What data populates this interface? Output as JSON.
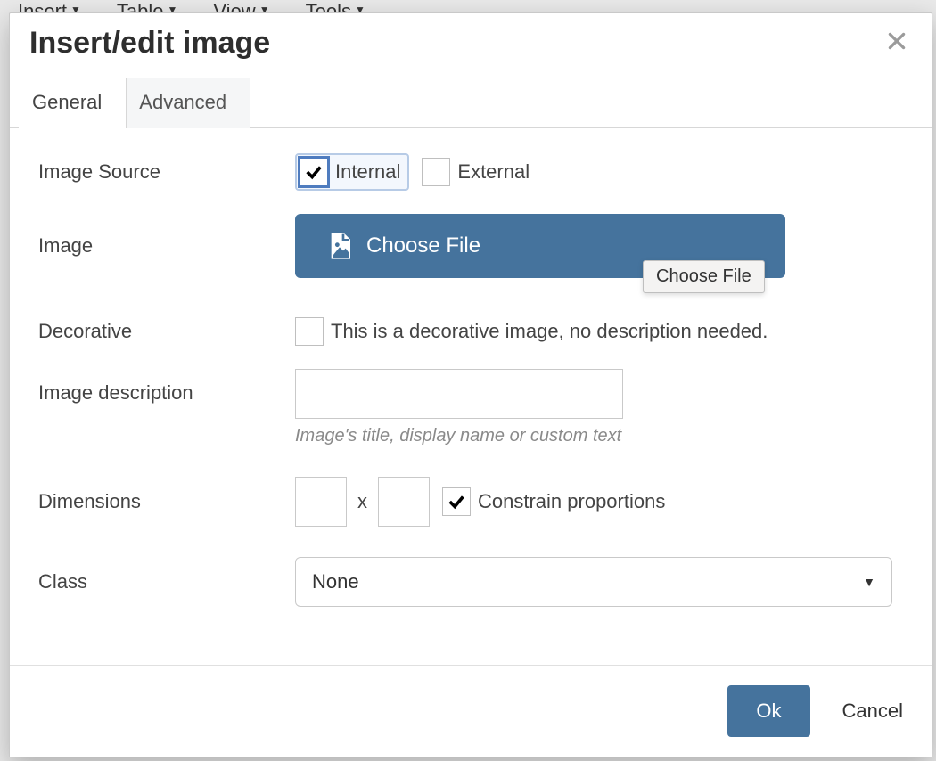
{
  "bg_menu": {
    "items": [
      "Insert",
      "Table",
      "View",
      "Tools"
    ]
  },
  "dialog": {
    "title": "Insert/edit image",
    "tabs": {
      "general": "General",
      "advanced": "Advanced"
    },
    "labels": {
      "image_source": "Image Source",
      "image": "Image",
      "decorative": "Decorative",
      "image_description": "Image description",
      "dimensions": "Dimensions",
      "class": "Class"
    },
    "source": {
      "internal": "Internal",
      "external": "External",
      "internal_checked": true,
      "external_checked": false
    },
    "choose_file": "Choose File",
    "tooltip": "Choose File",
    "decorative_text": "This is a decorative image, no description needed.",
    "decorative_checked": false,
    "description_value": "",
    "description_help": "Image's title, display name or custom text",
    "dimensions": {
      "width": "",
      "height": "",
      "separator": "x",
      "constrain_checked": true,
      "constrain_label": "Constrain proportions"
    },
    "class_value": "None",
    "buttons": {
      "ok": "Ok",
      "cancel": "Cancel"
    }
  }
}
